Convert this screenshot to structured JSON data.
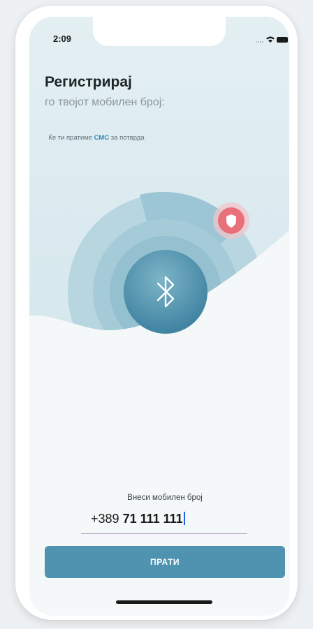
{
  "status": {
    "time": "2:09"
  },
  "header": {
    "title": "Регистрирај",
    "subtitle": "го твојот мобилен број:",
    "note_prefix": "Ќе ти пратиме ",
    "note_highlight": "СМС",
    "note_suffix": " за потврда"
  },
  "illustration": {
    "center_icon": "bluetooth-icon",
    "badge_icon": "shield-icon"
  },
  "form": {
    "label": "Внеси мобилен број",
    "prefix": "+389",
    "number": "71 111 111",
    "submit_label": "ПРАТИ"
  },
  "colors": {
    "accent": "#4f93b1",
    "highlight": "#2b8bb4",
    "badge": "#e9707a",
    "underline": "#b59ac2"
  }
}
